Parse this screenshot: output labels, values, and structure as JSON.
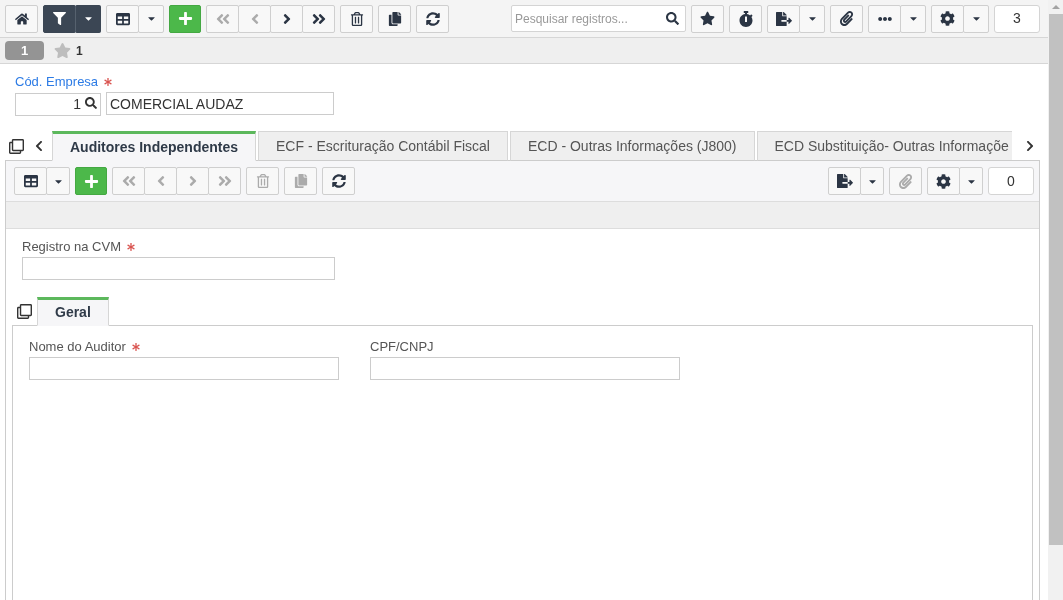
{
  "main_toolbar": {
    "left_buttons": [
      {
        "kind": "home",
        "disabled": false
      },
      {
        "kind": "filter",
        "disabled": false
      },
      {
        "kind": "view",
        "disabled": false
      },
      {
        "kind": "add",
        "disabled": false
      },
      {
        "kind": "first",
        "disabled": true
      },
      {
        "kind": "previous",
        "disabled": true
      },
      {
        "kind": "next",
        "disabled": false
      },
      {
        "kind": "last",
        "disabled": false
      },
      {
        "kind": "delete",
        "disabled": false
      },
      {
        "kind": "copy",
        "disabled": false
      },
      {
        "kind": "refresh",
        "disabled": false
      }
    ],
    "search": {
      "placeholder": "Pesquisar registros..."
    },
    "right_buttons": [
      {
        "kind": "favorite",
        "disabled": false
      },
      {
        "kind": "timer",
        "disabled": false
      },
      {
        "kind": "export",
        "disabled": false
      },
      {
        "kind": "attach",
        "disabled": false
      },
      {
        "kind": "more",
        "disabled": false
      },
      {
        "kind": "settings",
        "disabled": false
      }
    ],
    "record_count": "3"
  },
  "record_bar": {
    "record_number": "1",
    "favorites_count": "1"
  },
  "company": {
    "label": "Cód. Empresa",
    "required": true,
    "code": "1",
    "name": "COMERCIAL AUDAZ"
  },
  "tabs": [
    {
      "label": "Auditores Independentes",
      "selected": true
    },
    {
      "label": "ECF - Escrituração Contábil Fiscal",
      "selected": false
    },
    {
      "label": "ECD - Outras Informações (J800)",
      "selected": false
    },
    {
      "label": "ECD Substituição- Outras Informaçõe",
      "selected": false
    }
  ],
  "detail_panel": {
    "toolbar": {
      "left_buttons": [
        {
          "kind": "view",
          "disabled": false
        },
        {
          "kind": "add",
          "disabled": false
        },
        {
          "kind": "first",
          "disabled": true
        },
        {
          "kind": "previous",
          "disabled": true
        },
        {
          "kind": "next",
          "disabled": true
        },
        {
          "kind": "last",
          "disabled": true
        },
        {
          "kind": "delete",
          "disabled": true
        },
        {
          "kind": "copy",
          "disabled": true
        },
        {
          "kind": "refresh",
          "disabled": false
        }
      ],
      "right_buttons": [
        {
          "kind": "export",
          "disabled": false
        },
        {
          "kind": "attach",
          "disabled": true
        },
        {
          "kind": "settings",
          "disabled": false
        }
      ],
      "record_count": "0"
    },
    "fields": [
      {
        "label": "Registro na CVM",
        "required": true
      }
    ],
    "sub_tabs": [
      {
        "label": "Geral",
        "selected": true
      }
    ],
    "sub_fields": [
      {
        "label": "Nome do Auditor",
        "required": true
      },
      {
        "label": "CPF/CNPJ",
        "required": false
      }
    ]
  }
}
